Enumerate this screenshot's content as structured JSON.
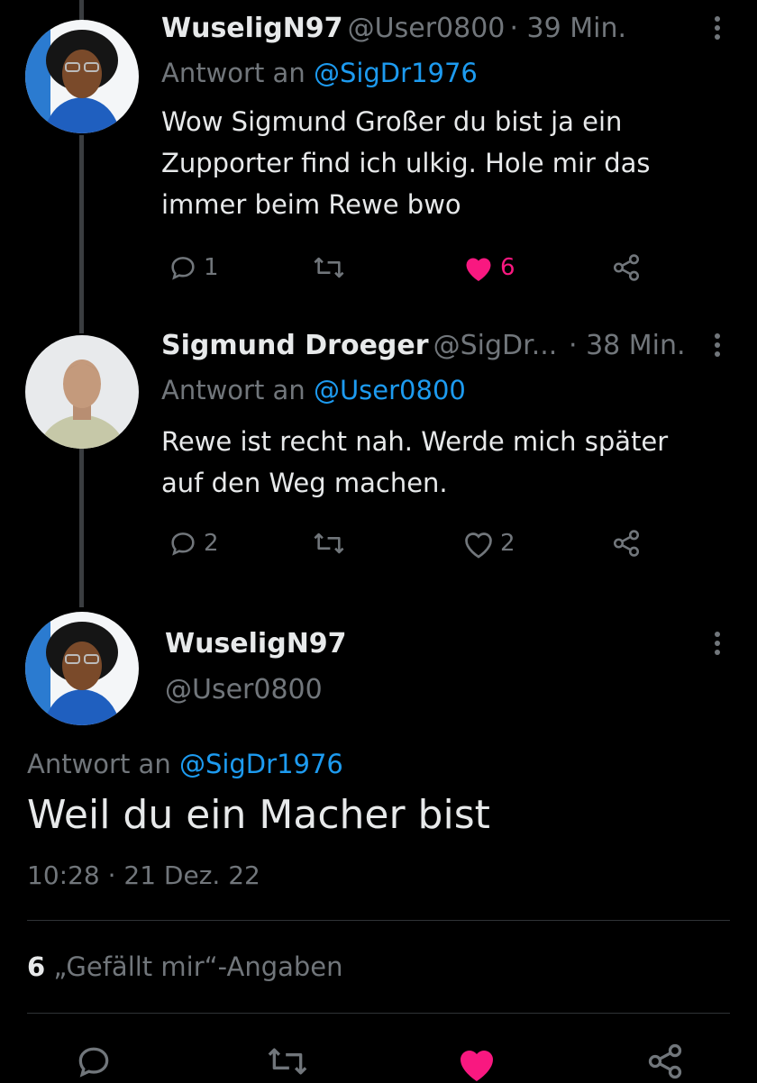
{
  "tweet1": {
    "name": "WuseligN97",
    "handle": "@User0800",
    "time": "· 39 Min.",
    "reply_prefix": "Antwort an",
    "reply_mention": "@SigDr1976",
    "text_lines": [
      "Wow Sigmund Großer du bist ja ein",
      "Zupporter find ich ulkig. Hole mir das",
      "immer beim Rewe bwo"
    ],
    "reply_count": "1",
    "like_count": "6",
    "liked": true
  },
  "tweet2": {
    "name": "Sigmund Droeger",
    "handle": "@SigDr...",
    "time": "· 38 Min.",
    "reply_prefix": "Antwort an",
    "reply_mention": "@User0800",
    "text_lines": [
      "Rewe ist recht nah. Werde mich später",
      "auf den Weg machen."
    ],
    "reply_count": "2",
    "like_count": "2",
    "liked": false
  },
  "main": {
    "name": "WuseligN97",
    "handle": "@User0800",
    "reply_prefix": "Antwort an",
    "reply_mention": "@SigDr1976",
    "text": "Weil du ein Macher bist",
    "timestamp": "10:28 · 21 Dez. 22",
    "likes_count": "6",
    "likes_label": "„Gefällt mir“-Angaben",
    "liked": true
  },
  "colors": {
    "accent": "#1d9bf0",
    "like": "#f91880",
    "muted": "#71767b",
    "background": "#000000"
  },
  "icons": [
    "more-icon",
    "reply-icon",
    "retweet-icon",
    "heart-icon",
    "share-icon"
  ]
}
